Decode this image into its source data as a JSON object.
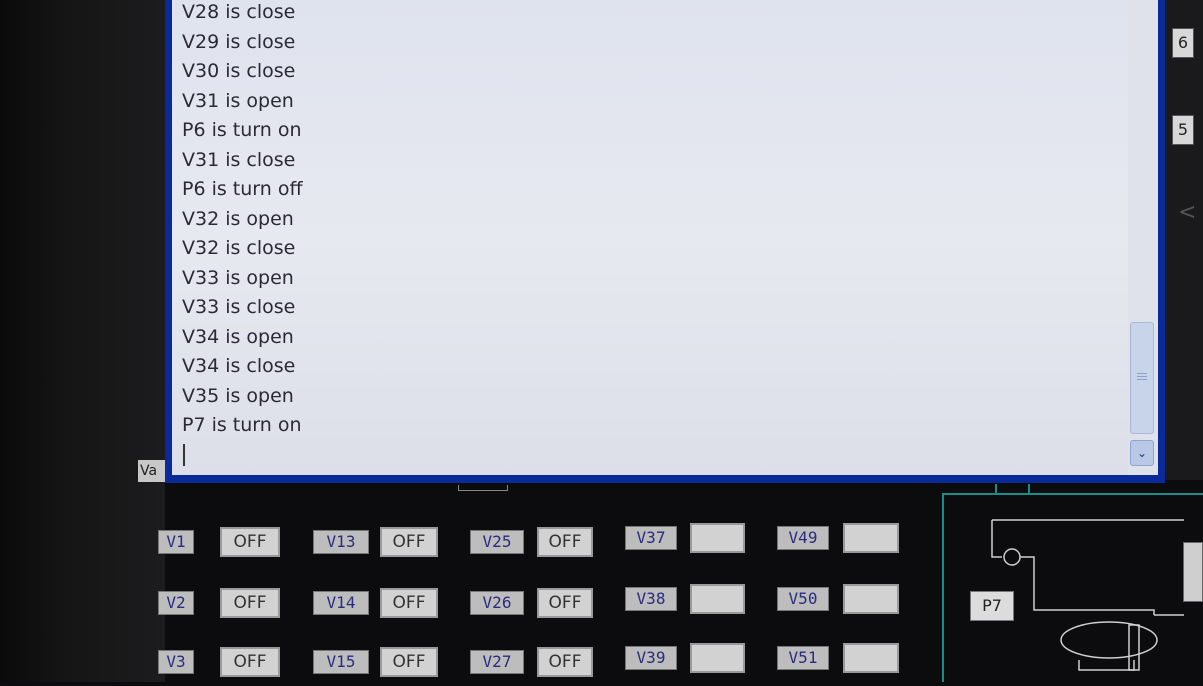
{
  "log": {
    "lines": [
      "V28 is close",
      "V29 is close",
      "V30 is close",
      "V31 is open",
      "P6 is turn on",
      "V31 is close",
      "P6 is turn off",
      "V32 is open",
      "V32 is close",
      "V33 is open",
      "V33 is close",
      "V34 is open",
      "V34 is close",
      "V35 is open",
      "P7 is turn on"
    ],
    "scroll_down_glyph": "⌄"
  },
  "side_buttons": {
    "top": "6",
    "middle": "5",
    "arrow": "<"
  },
  "partial_label": "Va",
  "valves": {
    "columns": [
      [
        {
          "label": "V1",
          "status": "OFF"
        },
        {
          "label": "V2",
          "status": "OFF"
        },
        {
          "label": "V3",
          "status": "OFF"
        }
      ],
      [
        {
          "label": "V13",
          "status": "OFF"
        },
        {
          "label": "V14",
          "status": "OFF"
        },
        {
          "label": "V15",
          "status": "OFF"
        }
      ],
      [
        {
          "label": "V25",
          "status": "OFF"
        },
        {
          "label": "V26",
          "status": "OFF"
        },
        {
          "label": "V27",
          "status": "OFF"
        }
      ],
      [
        {
          "label": "V37",
          "status": ""
        },
        {
          "label": "V38",
          "status": ""
        },
        {
          "label": "V39",
          "status": ""
        }
      ],
      [
        {
          "label": "V49",
          "status": ""
        },
        {
          "label": "V50",
          "status": ""
        },
        {
          "label": "V51",
          "status": ""
        }
      ]
    ]
  },
  "schematic": {
    "pump_label": "P7",
    "accent_color": "#1a8c8c"
  }
}
